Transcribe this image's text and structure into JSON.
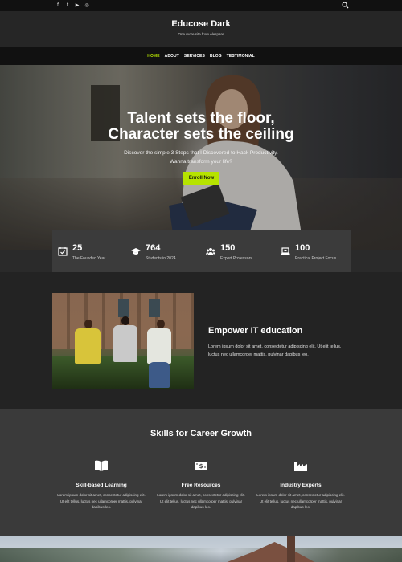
{
  "topbar": {
    "socials": [
      {
        "icon": "facebook-icon",
        "glyph": "f"
      },
      {
        "icon": "twitter-icon",
        "glyph": "t"
      },
      {
        "icon": "youtube-icon",
        "glyph": "▶"
      },
      {
        "icon": "instagram-icon",
        "glyph": "◎"
      }
    ],
    "search_icon": "search-icon"
  },
  "brand": {
    "title": "Educose Dark",
    "tagline": "One more site from elespare"
  },
  "nav": {
    "items": [
      "HOME",
      "ABOUT",
      "SERVICES",
      "BLOG",
      "TESTIMONIAL"
    ],
    "active": "HOME",
    "active_color": "#b6e300"
  },
  "hero": {
    "headline_line1": "Talent sets the floor,",
    "headline_line2": "Character sets the ceiling",
    "subtitle_line1": "Discover the simple 3 Steps that I Discovered to Hack Productivity.",
    "subtitle_line2": "Wanna transform your life?",
    "cta_label": "Enroll Now",
    "cta_color": "#b6e300"
  },
  "stats": [
    {
      "icon": "calendar-check-icon",
      "value": "25",
      "label": "The Founded Year"
    },
    {
      "icon": "graduation-cap-icon",
      "value": "764",
      "label": "Students in 2024"
    },
    {
      "icon": "users-icon",
      "value": "150",
      "label": "Expert Professors"
    },
    {
      "icon": "laptop-icon",
      "value": "100",
      "label": "Practical Project Focus"
    }
  ],
  "about": {
    "title": "Empower IT education",
    "text": "Lorem ipsum dolor sit amet, consectetur adipiscing elit. Ut elit tellus, luctus nec ullamcorper mattis, pulvinar dapibus leo."
  },
  "skills": {
    "title": "Skills for Career Growth",
    "features": [
      {
        "icon": "book-open-icon",
        "title": "Skill-based Learning",
        "text": "Lorem ipsum dolor sit amet, consectetur adipiscing elit. Ut elit tellus, luctus nec ullamcorper mattis, pulvinar dapibus leo."
      },
      {
        "icon": "money-bill-icon",
        "title": "Free Resources",
        "text": "Lorem ipsum dolor sit amet, consectetur adipiscing elit. Ut elit tellus, luctus nec ullamcorper mattis, pulvinar dapibus leo."
      },
      {
        "icon": "industry-icon",
        "title": "Industry Experts",
        "text": "Lorem ipsum dolor sit amet, consectetur adipiscing elit. Ut elit tellus, luctus nec ullamcorper mattis, pulvinar dapibus leo."
      }
    ]
  }
}
